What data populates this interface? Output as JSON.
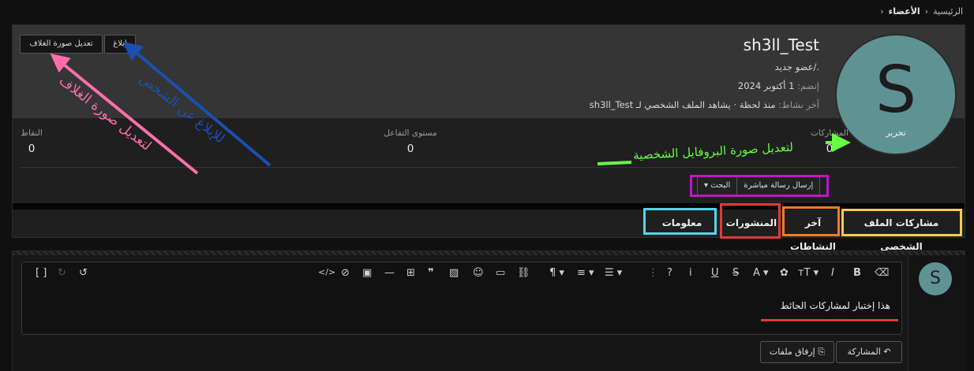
{
  "breadcrumb": {
    "home": "الرئيسية",
    "members": "الأعضاء"
  },
  "header": {
    "report_button": "إبلاغ",
    "edit_cover_button": "تعديل صورة الغلاف"
  },
  "profile": {
    "avatar_letter": "S",
    "avatar_edit": "تحرير",
    "username": "sh3ll_Test",
    "title": "./عضو جديد",
    "joined_label": "إنضم:",
    "joined_value": "1 أكتوبر 2024",
    "last_activity_label": "آخر نشاط:",
    "last_activity_value": "منذ لحظة · يشاهد الملف الشخصي لـ sh3ll_Test"
  },
  "stats": {
    "posts_label": "المشاركات",
    "posts_value": "0",
    "reaction_label": "مستوى التفاعل",
    "reaction_value": "0",
    "points_label": "النقاط",
    "points_value": "0"
  },
  "actions": {
    "send_message": "إرسال رسالة مباشرة",
    "search": "البحث"
  },
  "tabs": [
    "مشاركات الملف الشخصي",
    "آخر النشاطات",
    "المنشورات",
    "معلومات"
  ],
  "editor": {
    "avatar_letter": "S",
    "content": "هذا إختبار لمشاركات الحائط",
    "post_button": "المشاركة",
    "attach_button": "إرفاق ملفات"
  },
  "annotations": {
    "report": "للإبلاغ عن الشخص",
    "edit_cover": "لتعديل صورة الغلاف",
    "edit_avatar": "لتعديل صورة البروفايل الشخصية"
  },
  "colors": {
    "pink": "#ff6fa8",
    "blue": "#1b4fb0",
    "green": "#66ff44",
    "purple": "#c015c9",
    "yellow": "#f6cc4e",
    "orange": "#ef7b2a",
    "red": "#e23a35",
    "cyan": "#56d4e8"
  }
}
